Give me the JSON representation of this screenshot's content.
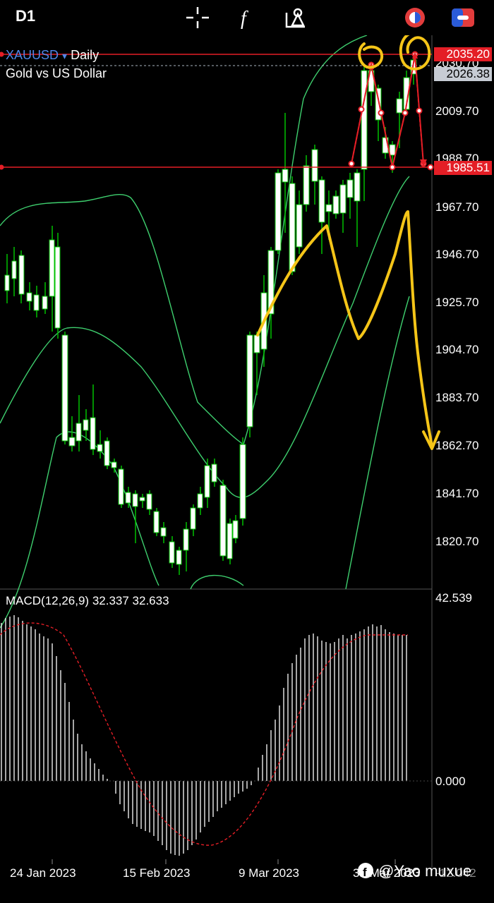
{
  "toolbar": {
    "timeframe": "D1",
    "icons": [
      "crosshair-icon",
      "function-icon",
      "objects-icon",
      "clock-icon",
      "trade-icon"
    ]
  },
  "symbol": {
    "name": "XAUUSD",
    "arrow": "▾",
    "period": "Daily",
    "description": "Gold vs US Dollar"
  },
  "price_axis": {
    "labels": [
      "2030.70",
      "2009.70",
      "1988.70",
      "1967.70",
      "1946.70",
      "1925.70",
      "1904.70",
      "1883.70",
      "1862.70",
      "1841.70",
      "1820.70"
    ],
    "red_level_top": "2035.20",
    "bid_level": "2026.38",
    "red_level_bottom": "1985.51"
  },
  "macd": {
    "label": "MACD(12,26,9) 32.337 32.633",
    "max": "42.539",
    "zero": "0.000",
    "bottom": "-12.042"
  },
  "date_axis": [
    "24 Jan 2023",
    "15 Feb 2023",
    "9 Mar 2023",
    "31 Mar 2023"
  ],
  "watermark": "@Yao muxue",
  "colors": {
    "candle_up": "#ffffff",
    "candle_wick": "#00c000",
    "band": "#3ecf6e",
    "red_line": "#e41e26",
    "annotation": "#f5c518",
    "macd_signal": "#e41e26"
  },
  "chart_data": {
    "type": "candlestick",
    "title": "XAUUSD Daily",
    "ylim": [
      1800,
      2040
    ],
    "dates": [
      "24 Jan 2023",
      "15 Feb 2023",
      "9 Mar 2023",
      "31 Mar 2023"
    ]
  }
}
